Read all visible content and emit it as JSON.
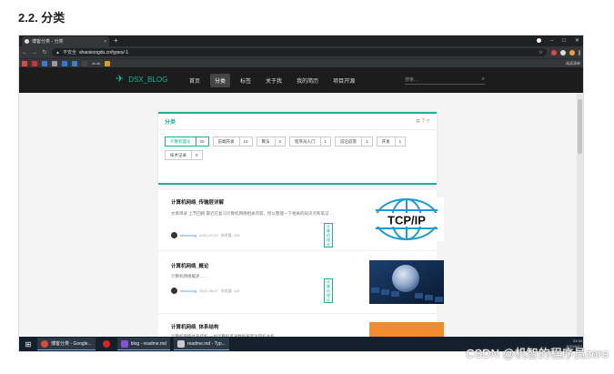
{
  "doc": {
    "heading": "2.2. 分类"
  },
  "browser": {
    "tab_title": "博客分类 - 分类",
    "tab_close": "×",
    "new_tab": "+",
    "insecure_label": "不安全",
    "url": "shaoxiongdu.cn/types/-1",
    "reading_list": "阅读清单",
    "bookmark_label": "zk.dk"
  },
  "site": {
    "logo_text": "DSX_BLOG",
    "nav": [
      "首页",
      "分类",
      "标签",
      "关于我",
      "我的简历",
      "项目开源"
    ],
    "search_placeholder": "搜索...",
    "card_title": "分类",
    "count_prefix": "共",
    "count_value": "7",
    "count_suffix": "个",
    "categories": [
      {
        "label": "计算机理论",
        "count": "20",
        "active": true
      },
      {
        "label": "前端开发",
        "count": "10"
      },
      {
        "label": "算法",
        "count": "2"
      },
      {
        "label": "程序员入门",
        "count": "1"
      },
      {
        "label": "前沿前景",
        "count": "1"
      },
      {
        "label": "开发",
        "count": "1"
      },
      {
        "label": "技术记录",
        "count": "0"
      }
    ],
    "posts": [
      {
        "title": "计算机网络_传输层详解",
        "desc": "文章目录 上节回顾 最近在复习计算机网络相关内容，所以整理一下相关的知识点和笔记…",
        "author": "shaoxiong",
        "date": "2021-07-07",
        "views": "浏览量: 125",
        "tag": "计算机理论",
        "image_text": "TCP/IP"
      },
      {
        "title": "计算机网络_概论",
        "desc": "计算机网络概述……",
        "author": "shaoxiong",
        "date": "2021-06-07",
        "views": "浏览量: 113",
        "tag": "计算机理论"
      },
      {
        "title": "计算机网络_体系结构",
        "desc": "计算机网络体系结构 一台计算机发送数据报到达目标主机…"
      }
    ]
  },
  "taskbar": {
    "items": [
      "博客分类 - Google...",
      "blog - readme.md",
      "readme.md - Typ..."
    ],
    "time": "21:34",
    "date": "2021/6/17"
  },
  "watermark": "CSDN @机智的程序员zero",
  "colors": {
    "accent": "#1ab394",
    "count": "#f29b2e",
    "nav_bg": "#1c1c1c"
  }
}
